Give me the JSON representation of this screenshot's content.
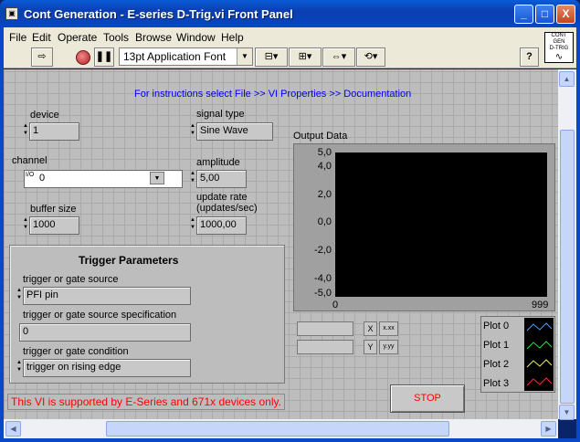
{
  "window": {
    "title": "Cont Generation - E-series D-Trig.vi Front Panel",
    "minimize": "_",
    "maximize": "□",
    "close": "X"
  },
  "menu": [
    "File",
    "Edit",
    "Operate",
    "Tools",
    "Browse",
    "Window",
    "Help"
  ],
  "toolbar": {
    "font": "13pt Application Font",
    "help": "?"
  },
  "vi_icon": {
    "line1": "CONT GEN",
    "line2": "D-TRIG"
  },
  "panel": {
    "instructions": "For instructions select File >> VI Properties >> Documentation",
    "device": {
      "label": "device",
      "value": "1"
    },
    "signal_type": {
      "label": "signal type",
      "value": "Sine Wave"
    },
    "channel": {
      "label": "channel",
      "value": "0",
      "prefix": "I/O"
    },
    "amplitude": {
      "label": "amplitude",
      "value": "5,00"
    },
    "buffer_size": {
      "label": "buffer size",
      "value": "1000"
    },
    "update_rate": {
      "label_line1": "update rate",
      "label_line2": "(updates/sec)",
      "value": "1000,00"
    },
    "trigger": {
      "title": "Trigger Parameters",
      "source_label": "trigger or gate source",
      "source_value": "PFI pin",
      "spec_label": "trigger or gate source specification",
      "spec_value": "0",
      "condition_label": "trigger or gate condition",
      "condition_value": "trigger on rising edge"
    },
    "support_note": "This VI is supported by E-Series and 671x devices only.",
    "stop_label": "STOP"
  },
  "graph": {
    "label": "Output Data",
    "y_ticks": [
      "5,0",
      "4,0",
      "2,0",
      "0,0",
      "-2,0",
      "-4,0",
      "-5,0"
    ],
    "x_ticks": [
      "0",
      "999"
    ],
    "scale_x": "X",
    "scale_y": "Y",
    "format_x": "x.xx",
    "format_y": "y.yy"
  },
  "legend": [
    {
      "label": "Plot 0",
      "color": "#4aa0ff"
    },
    {
      "label": "Plot 1",
      "color": "#2ee04a"
    },
    {
      "label": "Plot 2",
      "color": "#f2f25a"
    },
    {
      "label": "Plot 3",
      "color": "#ff3030"
    }
  ]
}
